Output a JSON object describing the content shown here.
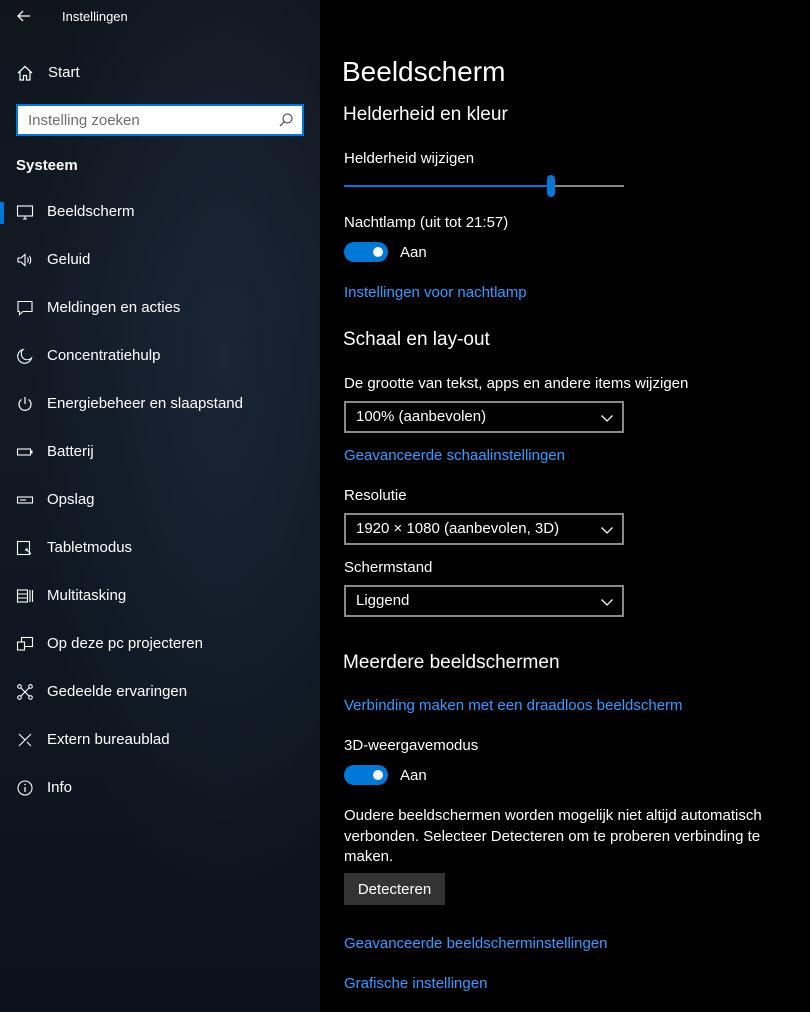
{
  "window": {
    "title": "Instellingen"
  },
  "sidebar": {
    "home_label": "Start",
    "search_placeholder": "Instelling zoeken",
    "section_title": "Systeem",
    "items": [
      {
        "label": "Beeldscherm",
        "icon": "monitor-icon",
        "active": true
      },
      {
        "label": "Geluid",
        "icon": "speaker-icon"
      },
      {
        "label": "Meldingen en acties",
        "icon": "notification-icon"
      },
      {
        "label": "Concentratiehulp",
        "icon": "moon-icon"
      },
      {
        "label": "Energiebeheer en slaapstand",
        "icon": "power-icon"
      },
      {
        "label": "Batterij",
        "icon": "battery-icon"
      },
      {
        "label": "Opslag",
        "icon": "storage-icon"
      },
      {
        "label": "Tabletmodus",
        "icon": "tablet-icon"
      },
      {
        "label": "Multitasking",
        "icon": "multitasking-icon"
      },
      {
        "label": "Op deze pc projecteren",
        "icon": "project-icon"
      },
      {
        "label": "Gedeelde ervaringen",
        "icon": "shared-icon"
      },
      {
        "label": "Extern bureaublad",
        "icon": "remote-icon"
      },
      {
        "label": "Info",
        "icon": "info-icon"
      }
    ]
  },
  "main": {
    "title": "Beeldscherm",
    "brightness": {
      "heading": "Helderheid en kleur",
      "label": "Helderheid wijzigen",
      "value_fraction": 0.74,
      "nightlight_label": "Nachtlamp (uit tot 21:57)",
      "nightlight_state": "Aan",
      "nightlight_link": "Instellingen voor nachtlamp"
    },
    "scale": {
      "heading": "Schaal en lay-out",
      "size_label": "De grootte van tekst, apps en andere items wijzigen",
      "size_value": "100% (aanbevolen)",
      "advanced_link": "Geavanceerde schaalinstellingen",
      "resolution_label": "Resolutie",
      "resolution_value": "1920 × 1080 (aanbevolen, 3D)",
      "orientation_label": "Schermstand",
      "orientation_value": "Liggend"
    },
    "multi": {
      "heading": "Meerdere beeldschermen",
      "wireless_link": "Verbinding maken met een draadloos beeldscherm",
      "mode3d_label": "3D-weergavemodus",
      "mode3d_state": "Aan",
      "info_text": "Oudere beeldschermen worden mogelijk niet altijd automatisch verbonden. Selecteer Detecteren om te proberen verbinding te maken.",
      "detect_button": "Detecteren",
      "advanced_display_link": "Geavanceerde beeldscherminstellingen",
      "graphics_link": "Grafische instellingen"
    }
  },
  "colors": {
    "accent": "#0078d7",
    "link": "#3c9aff",
    "background": "#000000"
  }
}
